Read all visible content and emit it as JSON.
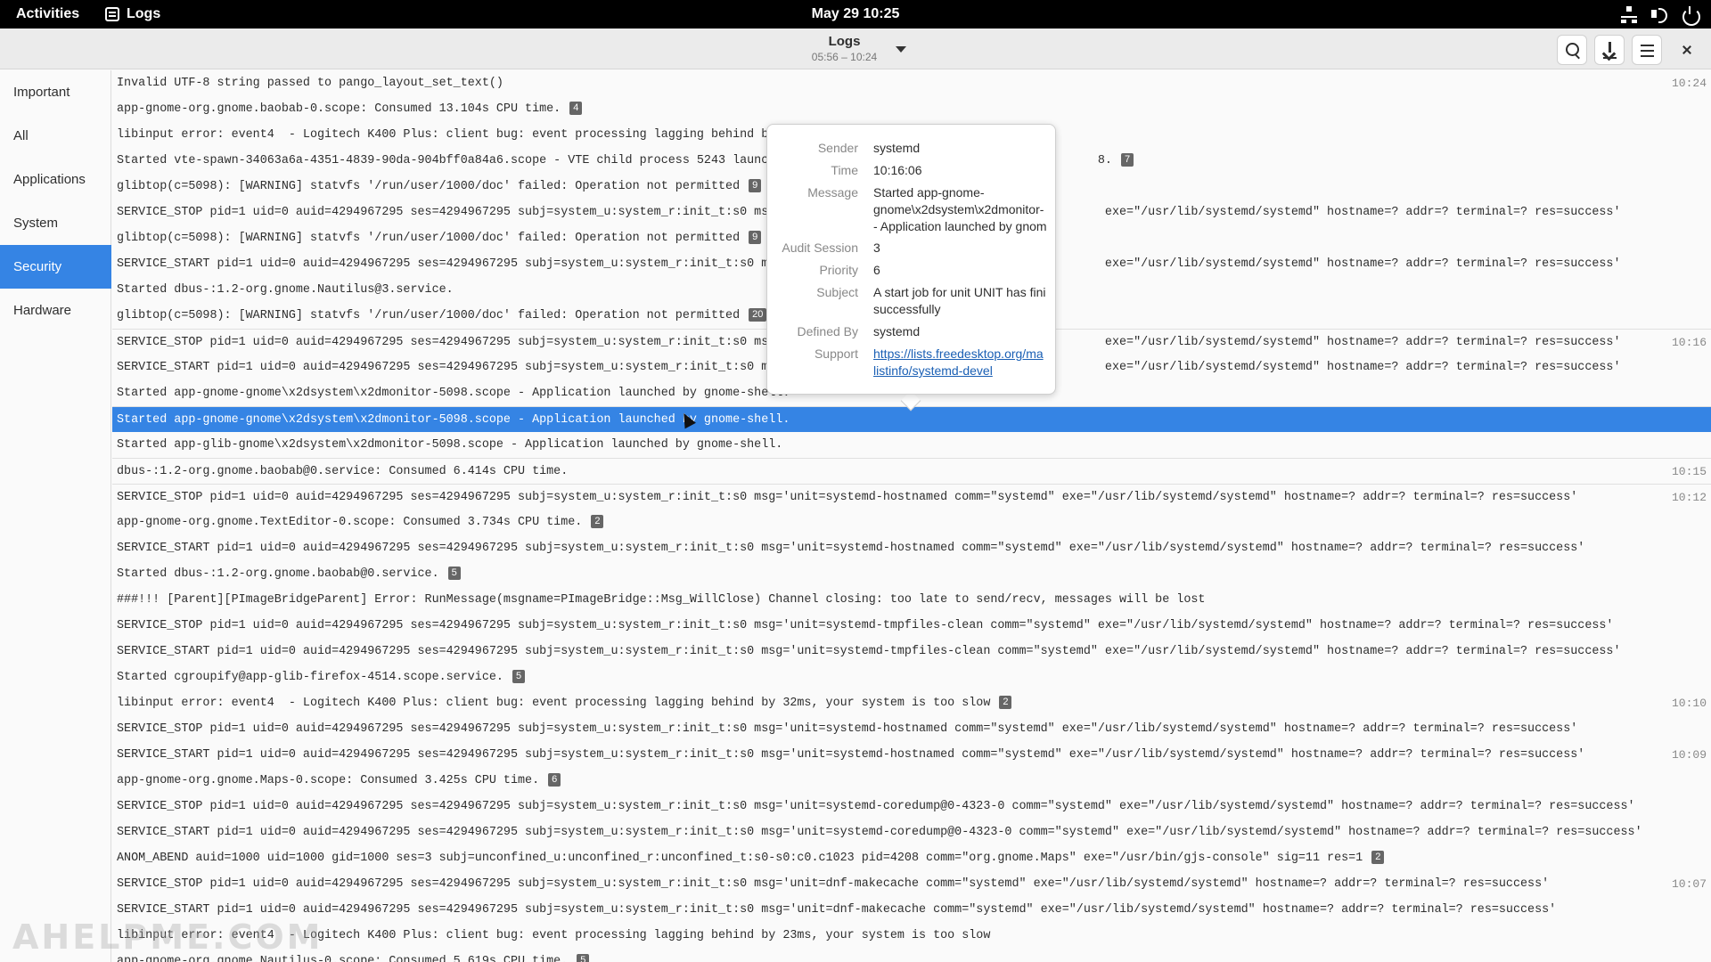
{
  "topbar": {
    "activities": "Activities",
    "app_name": "Logs",
    "clock": "May 29  10:25",
    "tray_icons": [
      "network-icon",
      "volume-icon",
      "power-icon"
    ]
  },
  "header": {
    "title": "Logs",
    "subtitle": "05:56 – 10:24"
  },
  "sidebar": {
    "items": [
      {
        "label": "Important"
      },
      {
        "label": "All"
      },
      {
        "label": "Applications"
      },
      {
        "label": "System"
      },
      {
        "label": "Security",
        "active": true
      },
      {
        "label": "Hardware"
      }
    ]
  },
  "rows": [
    {
      "msg": "Invalid UTF-8 string passed to pango_layout_set_text()",
      "count": "",
      "time": "10:24"
    },
    {
      "msg": "app-gnome-org.gnome.baobab-0.scope: Consumed 13.104s CPU time.",
      "count": "4",
      "time": ""
    },
    {
      "msg": "libinput error: event4  - Logitech K400 Plus: client bug: event processing lagging behind by",
      "count": "",
      "time": ""
    },
    {
      "msg": "Started vte-spawn-34063a6a-4351-4839-90da-904bff0a84a6.scope - VTE child process 5243 launc                                              8.",
      "count": "7",
      "time": ""
    },
    {
      "msg": "glibtop(c=5098): [WARNING] statvfs '/run/user/1000/doc' failed: Operation not permitted",
      "count": "9",
      "time": ""
    },
    {
      "msg": "SERVICE_STOP pid=1 uid=0 auid=4294967295 ses=4294967295 subj=system_u:system_r:init_t:s0 msg                                              exe=\"/usr/lib/systemd/systemd\" hostname=? addr=? terminal=? res=success'",
      "count": "",
      "time": ""
    },
    {
      "msg": "glibtop(c=5098): [WARNING] statvfs '/run/user/1000/doc' failed: Operation not permitted",
      "count": "9",
      "time": ""
    },
    {
      "msg": "SERVICE_START pid=1 uid=0 auid=4294967295 ses=4294967295 subj=system_u:system_r:init_t:s0 ms                                              exe=\"/usr/lib/systemd/systemd\" hostname=? addr=? terminal=? res=success'",
      "count": "",
      "time": ""
    },
    {
      "msg": "Started dbus-:1.2-org.gnome.Nautilus@3.service.",
      "count": "",
      "time": ""
    },
    {
      "msg": "glibtop(c=5098): [WARNING] statvfs '/run/user/1000/doc' failed: Operation not permitted",
      "count": "20",
      "time": ""
    },
    {
      "msg": "SERVICE_STOP pid=1 uid=0 auid=4294967295 ses=4294967295 subj=system_u:system_r:init_t:s0 msg                                              exe=\"/usr/lib/systemd/systemd\" hostname=? addr=? terminal=? res=success'",
      "count": "",
      "time": "10:16"
    },
    {
      "msg": "SERVICE_START pid=1 uid=0 auid=4294967295 ses=4294967295 subj=system_u:system_r:init_t:s0 ms                                              exe=\"/usr/lib/systemd/systemd\" hostname=? addr=? terminal=? res=success'",
      "count": "",
      "time": ""
    },
    {
      "msg": "Started app-gnome-gnome\\x2dsystem\\x2dmonitor-5098.scope - Application launched by gnome-shell.",
      "count": "",
      "time": ""
    },
    {
      "msg": "Started app-gnome-gnome\\x2dsystem\\x2dmonitor-5098.scope - Application launched by gnome-shell.",
      "count": "",
      "time": "",
      "selected": true
    },
    {
      "msg": "Started app-glib-gnome\\x2dsystem\\x2dmonitor-5098.scope - Application launched by gnome-shell.",
      "count": "",
      "time": ""
    },
    {
      "msg": "dbus-:1.2-org.gnome.baobab@0.service: Consumed 6.414s CPU time.",
      "count": "",
      "time": "10:15"
    },
    {
      "msg": "SERVICE_STOP pid=1 uid=0 auid=4294967295 ses=4294967295 subj=system_u:system_r:init_t:s0 msg='unit=systemd-hostnamed comm=\"systemd\" exe=\"/usr/lib/systemd/systemd\" hostname=? addr=? terminal=? res=success'",
      "count": "",
      "time": "10:12"
    },
    {
      "msg": "app-gnome-org.gnome.TextEditor-0.scope: Consumed 3.734s CPU time.",
      "count": "2",
      "time": ""
    },
    {
      "msg": "SERVICE_START pid=1 uid=0 auid=4294967295 ses=4294967295 subj=system_u:system_r:init_t:s0 msg='unit=systemd-hostnamed comm=\"systemd\" exe=\"/usr/lib/systemd/systemd\" hostname=? addr=? terminal=? res=success'",
      "count": "",
      "time": ""
    },
    {
      "msg": "Started dbus-:1.2-org.gnome.baobab@0.service.",
      "count": "5",
      "time": ""
    },
    {
      "msg": "###!!! [Parent][PImageBridgeParent] Error: RunMessage(msgname=PImageBridge::Msg_WillClose) Channel closing: too late to send/recv, messages will be lost",
      "count": "",
      "time": ""
    },
    {
      "msg": "SERVICE_STOP pid=1 uid=0 auid=4294967295 ses=4294967295 subj=system_u:system_r:init_t:s0 msg='unit=systemd-tmpfiles-clean comm=\"systemd\" exe=\"/usr/lib/systemd/systemd\" hostname=? addr=? terminal=? res=success'",
      "count": "",
      "time": ""
    },
    {
      "msg": "SERVICE_START pid=1 uid=0 auid=4294967295 ses=4294967295 subj=system_u:system_r:init_t:s0 msg='unit=systemd-tmpfiles-clean comm=\"systemd\" exe=\"/usr/lib/systemd/systemd\" hostname=? addr=? terminal=? res=success'",
      "count": "",
      "time": ""
    },
    {
      "msg": "Started cgroupify@app-glib-firefox-4514.scope.service.",
      "count": "5",
      "time": ""
    },
    {
      "msg": "libinput error: event4  - Logitech K400 Plus: client bug: event processing lagging behind by 32ms, your system is too slow",
      "count": "2",
      "time": "10:10"
    },
    {
      "msg": "SERVICE_STOP pid=1 uid=0 auid=4294967295 ses=4294967295 subj=system_u:system_r:init_t:s0 msg='unit=systemd-hostnamed comm=\"systemd\" exe=\"/usr/lib/systemd/systemd\" hostname=? addr=? terminal=? res=success'",
      "count": "",
      "time": ""
    },
    {
      "msg": "SERVICE_START pid=1 uid=0 auid=4294967295 ses=4294967295 subj=system_u:system_r:init_t:s0 msg='unit=systemd-hostnamed comm=\"systemd\" exe=\"/usr/lib/systemd/systemd\" hostname=? addr=? terminal=? res=success'",
      "count": "",
      "time": "10:09"
    },
    {
      "msg": "app-gnome-org.gnome.Maps-0.scope: Consumed 3.425s CPU time.",
      "count": "6",
      "time": ""
    },
    {
      "msg": "SERVICE_STOP pid=1 uid=0 auid=4294967295 ses=4294967295 subj=system_u:system_r:init_t:s0 msg='unit=systemd-coredump@0-4323-0 comm=\"systemd\" exe=\"/usr/lib/systemd/systemd\" hostname=? addr=? terminal=? res=success'",
      "count": "",
      "time": ""
    },
    {
      "msg": "SERVICE_START pid=1 uid=0 auid=4294967295 ses=4294967295 subj=system_u:system_r:init_t:s0 msg='unit=systemd-coredump@0-4323-0 comm=\"systemd\" exe=\"/usr/lib/systemd/systemd\" hostname=? addr=? terminal=? res=success'",
      "count": "",
      "time": ""
    },
    {
      "msg": "ANOM_ABEND auid=1000 uid=1000 gid=1000 ses=3 subj=unconfined_u:unconfined_r:unconfined_t:s0-s0:c0.c1023 pid=4208 comm=\"org.gnome.Maps\" exe=\"/usr/bin/gjs-console\" sig=11 res=1",
      "count": "2",
      "time": ""
    },
    {
      "msg": "SERVICE_STOP pid=1 uid=0 auid=4294967295 ses=4294967295 subj=system_u:system_r:init_t:s0 msg='unit=dnf-makecache comm=\"systemd\" exe=\"/usr/lib/systemd/systemd\" hostname=? addr=? terminal=? res=success'",
      "count": "",
      "time": "10:07"
    },
    {
      "msg": "SERVICE_START pid=1 uid=0 auid=4294967295 ses=4294967295 subj=system_u:system_r:init_t:s0 msg='unit=dnf-makecache comm=\"systemd\" exe=\"/usr/lib/systemd/systemd\" hostname=? addr=? terminal=? res=success'",
      "count": "",
      "time": ""
    },
    {
      "msg": "libinput error: event4  - Logitech K400 Plus: client bug: event processing lagging behind by 23ms, your system is too slow",
      "count": "",
      "time": ""
    },
    {
      "msg": "app-gnome-org.gnome.Nautilus-0.scope: Consumed 5.619s CPU time.",
      "count": "5",
      "time": ""
    }
  ],
  "popover": {
    "fields": [
      {
        "label": "Sender",
        "value": "systemd"
      },
      {
        "label": "Time",
        "value": "10:16:06"
      },
      {
        "label": "Message",
        "value": "Started app-gnome-gnome\\x2dsystem\\x2dmonitor-5098.scope - Application launched by gnome-shell."
      },
      {
        "label": "Audit Session",
        "value": "3"
      },
      {
        "label": "Priority",
        "value": "6"
      },
      {
        "label": "Subject",
        "value": "A start job for unit UNIT has finished successfully"
      },
      {
        "label": "Defined By",
        "value": "systemd"
      },
      {
        "label": "Support",
        "value": "https://lists.freedesktop.org/mailman/listinfo/systemd-devel"
      }
    ],
    "message_lines": [
      "Started app-gnome-",
      "gnome\\x2dsystem\\x2dmonitor-",
      "- Application launched by gnom"
    ],
    "subject_lines": [
      "A start job for unit UNIT has fini",
      "successfully"
    ],
    "support_lines": [
      "https://lists.freedesktop.org/ma",
      "listinfo/systemd-devel"
    ]
  },
  "watermark": "AHELPME.COM",
  "colors": {
    "accent": "#3584e4",
    "topbar": "#000000",
    "link": "#1a5fb4"
  }
}
